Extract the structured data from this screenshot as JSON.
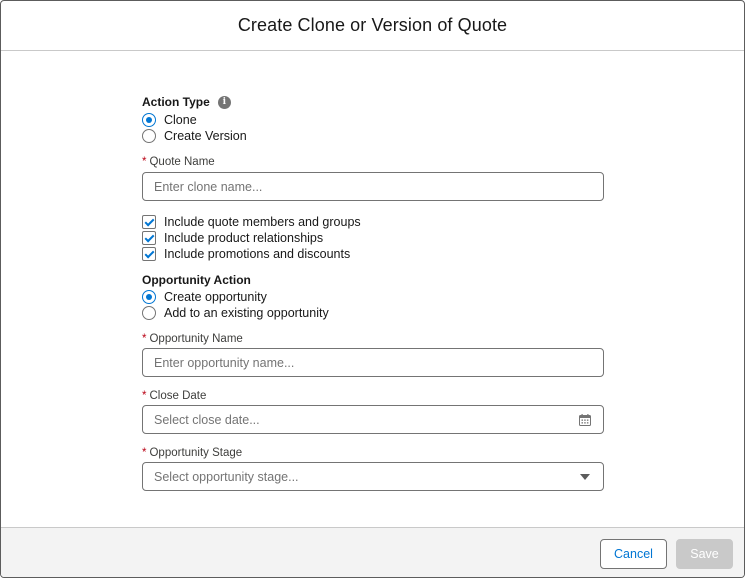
{
  "modal": {
    "title": "Create Clone or Version of Quote"
  },
  "action_type": {
    "label": "Action Type",
    "info_icon": "info-icon",
    "options": [
      {
        "label": "Clone",
        "selected": true
      },
      {
        "label": "Create Version",
        "selected": false
      }
    ]
  },
  "quote_name": {
    "required_marker": "*",
    "label": "Quote Name",
    "placeholder": "Enter clone name..."
  },
  "includes": [
    {
      "label": "Include quote members and groups",
      "checked": true
    },
    {
      "label": "Include product relationships",
      "checked": true
    },
    {
      "label": "Include promotions and discounts",
      "checked": true
    }
  ],
  "opportunity_action": {
    "label": "Opportunity Action",
    "options": [
      {
        "label": "Create opportunity",
        "selected": true
      },
      {
        "label": "Add to an existing opportunity",
        "selected": false
      }
    ]
  },
  "opportunity_name": {
    "required_marker": "*",
    "label": "Opportunity Name",
    "placeholder": "Enter opportunity name..."
  },
  "close_date": {
    "required_marker": "*",
    "label": "Close Date",
    "placeholder": "Select close date...",
    "icon": "calendar-icon"
  },
  "opportunity_stage": {
    "required_marker": "*",
    "label": "Opportunity Stage",
    "placeholder": "Select opportunity stage...",
    "icon": "chevron-down-icon"
  },
  "footer": {
    "cancel_label": "Cancel",
    "save_label": "Save"
  },
  "colors": {
    "brand": "#0176d3",
    "required": "#ba0517",
    "disabled_button": "#c9c9c9",
    "footer_bg": "#f3f3f3"
  }
}
